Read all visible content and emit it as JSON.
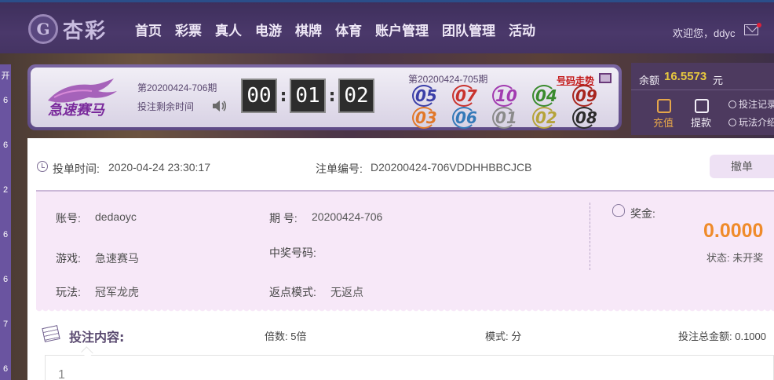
{
  "header": {
    "logo_text": "杏彩",
    "nav": [
      "首页",
      "彩票",
      "真人",
      "电游",
      "棋牌",
      "体育",
      "账户管理",
      "团队管理",
      "活动"
    ],
    "welcome": "欢迎您，ddyc"
  },
  "left_strip": [
    "开",
    "6",
    "6",
    "2",
    "6",
    "6",
    "7",
    "6"
  ],
  "game": {
    "name": "急速赛马",
    "current_period": "第20200424-706期",
    "countdown_label": "投注剩余时间",
    "timer": [
      "00",
      "01",
      "02"
    ],
    "last_period": "第20200424-705期",
    "trend_link": "号码走势",
    "results": [
      {
        "num": "05",
        "color": "#3b3fa8"
      },
      {
        "num": "07",
        "color": "#c9332e"
      },
      {
        "num": "10",
        "color": "#a23bb0"
      },
      {
        "num": "04",
        "color": "#3a8b2e"
      },
      {
        "num": "09",
        "color": "#a8251e"
      },
      {
        "num": "03",
        "color": "#e1782a"
      },
      {
        "num": "06",
        "color": "#3479b8"
      },
      {
        "num": "01",
        "color": "#8a8a8a"
      },
      {
        "num": "02",
        "color": "#b5a33a"
      },
      {
        "num": "08",
        "color": "#2b2b2b"
      }
    ]
  },
  "balance": {
    "label": "余额",
    "value": "16.5573",
    "unit": "元",
    "recharge": "充值",
    "withdraw": "提款",
    "bet_record": "投注记录",
    "rules": "玩法介绍"
  },
  "order": {
    "bet_time_label": "投单时间:",
    "bet_time": "2020-04-24 23:30:17",
    "order_no_label": "注单编号:",
    "order_no": "D20200424-706VDDHHBBCJCB",
    "cancel": "撤单",
    "account_label": "账号:",
    "account": "dedaoyc",
    "period_label": "期 号:",
    "period": "20200424-706",
    "game_label": "游戏:",
    "game": "急速赛马",
    "win_num_label": "中奖号码:",
    "win_num": "",
    "play_label": "玩法:",
    "play": "冠军龙虎",
    "rebate_label": "返点模式:",
    "rebate": "无返点",
    "prize_label": "奖金:",
    "prize": "0.0000",
    "status": "状态: 未开奖",
    "content_title": "投注内容:",
    "multiple": "倍数:  5倍",
    "mode": "模式:  分",
    "total": "投注总金额: 0.1000",
    "content": "1"
  }
}
